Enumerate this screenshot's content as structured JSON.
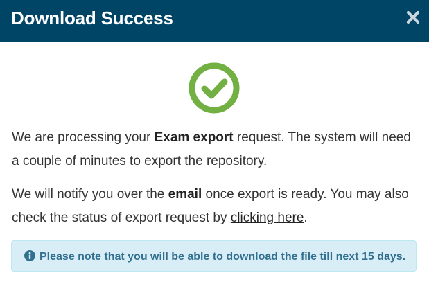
{
  "dialog": {
    "title": "Download Success",
    "close_icon": "close-icon",
    "success_icon": "check-circle-icon",
    "colors": {
      "header_bg": "#004466",
      "success_green": "#72b043",
      "info_bg": "#d9edf7",
      "info_text": "#31708f"
    }
  },
  "message": {
    "para1_before": "We are processing your ",
    "para1_bold": "Exam export",
    "para1_after": " request. The system will need a couple of minutes to export the repository.",
    "para2_before": "We will notify you over the ",
    "para2_bold": "email",
    "para2_after": " once export is ready. You may also check the status of export request by ",
    "para2_link": "clicking here",
    "para2_end": "."
  },
  "notice": {
    "icon": "info-circle-icon",
    "text": "Please note that you will be able to download the file till next 15 days."
  }
}
